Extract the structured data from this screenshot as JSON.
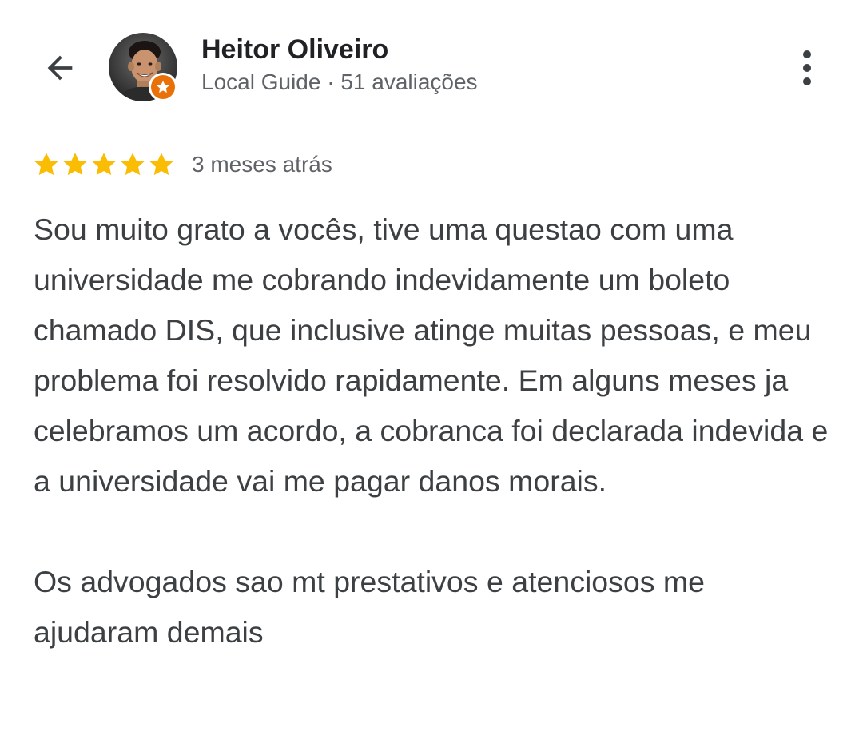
{
  "header": {
    "back_icon": "arrow-back-icon",
    "user_name": "Heitor Oliveiro",
    "user_meta": "Local Guide · 51 avaliações",
    "avatar_badge_icon": "star-badge-icon",
    "more_icon": "more-vert-icon"
  },
  "review": {
    "rating": 5,
    "rating_max": 5,
    "star_color": "#fbbc04",
    "date": "3 meses atrás",
    "paragraphs": [
      "Sou muito grato a vocês, tive uma questao com uma universidade me cobrando indevidamente um boleto chamado DIS, que inclusive atinge muitas pessoas, e meu problema foi resolvido rapidamente. Em alguns meses ja celebramos um acordo, a cobranca foi declarada indevida e a universidade vai me pagar danos morais.",
      "Os advogados sao mt prestativos e atenciosos me ajudaram demais"
    ]
  },
  "colors": {
    "badge": "#e8710a",
    "text_primary": "#202124",
    "text_secondary": "#5f6368",
    "text_body": "#3c4043"
  }
}
